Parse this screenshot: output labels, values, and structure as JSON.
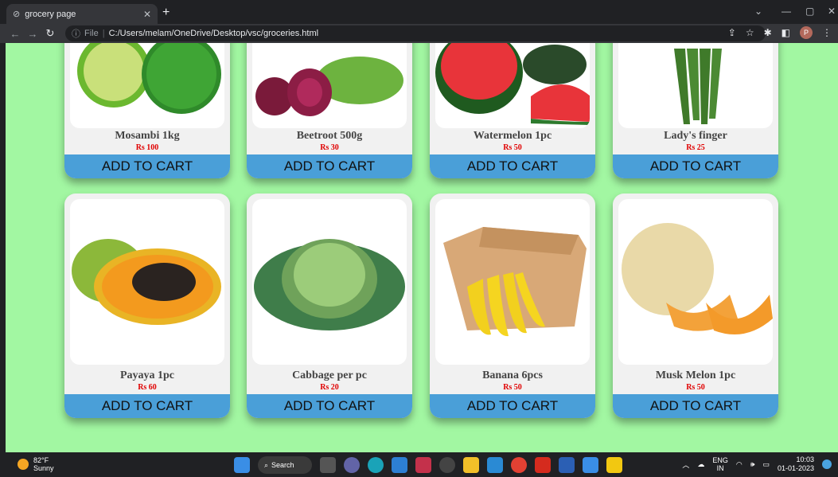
{
  "browser": {
    "tab_title": "grocery page",
    "tab_close": "✕",
    "new_tab": "+",
    "file_label": "File",
    "address": "C:/Users/melam/OneDrive/Desktop/vsc/groceries.html",
    "profile_initial": "P"
  },
  "products": [
    {
      "name": "Mosambi 1kg",
      "price": "Rs 100",
      "cart_label": "ADD TO CART"
    },
    {
      "name": "Beetroot 500g",
      "price": "Rs 30",
      "cart_label": "ADD TO CART"
    },
    {
      "name": "Watermelon 1pc",
      "price": "Rs 50",
      "cart_label": "ADD TO CART"
    },
    {
      "name": "Lady's finger",
      "price": "Rs 25",
      "cart_label": "ADD TO CART"
    },
    {
      "name": "Payaya 1pc",
      "price": "Rs 60",
      "cart_label": "ADD TO CART"
    },
    {
      "name": "Cabbage per pc",
      "price": "Rs 20",
      "cart_label": "ADD TO CART"
    },
    {
      "name": "Banana 6pcs",
      "price": "Rs 50",
      "cart_label": "ADD TO CART"
    },
    {
      "name": "Musk Melon 1pc",
      "price": "Rs 50",
      "cart_label": "ADD TO CART"
    }
  ],
  "taskbar": {
    "temperature": "82°F",
    "condition": "Sunny",
    "search_label": "Search",
    "lang_top": "ENG",
    "lang_bottom": "IN",
    "time": "10:03",
    "date": "01-01-2023"
  },
  "colors": {
    "page_background": "#a2f7a2",
    "cart_button": "#4a9fd8",
    "price_text": "#e00000"
  }
}
